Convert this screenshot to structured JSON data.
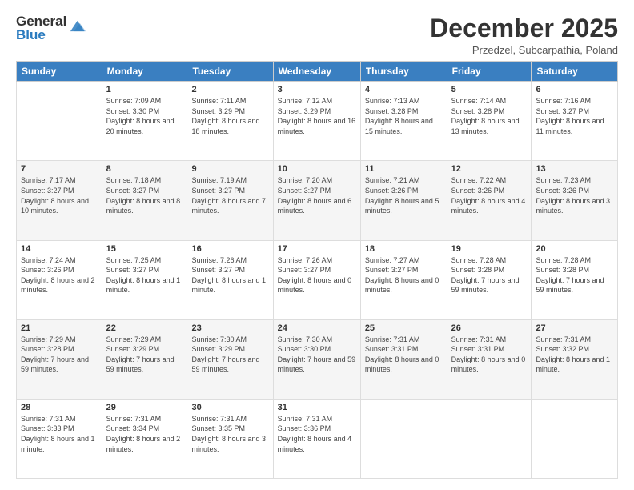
{
  "logo": {
    "general": "General",
    "blue": "Blue"
  },
  "header": {
    "month": "December 2025",
    "location": "Przedzel, Subcarpathia, Poland"
  },
  "days_of_week": [
    "Sunday",
    "Monday",
    "Tuesday",
    "Wednesday",
    "Thursday",
    "Friday",
    "Saturday"
  ],
  "weeks": [
    [
      {
        "day": "",
        "sunrise": "",
        "sunset": "",
        "daylight": ""
      },
      {
        "day": "1",
        "sunrise": "Sunrise: 7:09 AM",
        "sunset": "Sunset: 3:30 PM",
        "daylight": "Daylight: 8 hours and 20 minutes."
      },
      {
        "day": "2",
        "sunrise": "Sunrise: 7:11 AM",
        "sunset": "Sunset: 3:29 PM",
        "daylight": "Daylight: 8 hours and 18 minutes."
      },
      {
        "day": "3",
        "sunrise": "Sunrise: 7:12 AM",
        "sunset": "Sunset: 3:29 PM",
        "daylight": "Daylight: 8 hours and 16 minutes."
      },
      {
        "day": "4",
        "sunrise": "Sunrise: 7:13 AM",
        "sunset": "Sunset: 3:28 PM",
        "daylight": "Daylight: 8 hours and 15 minutes."
      },
      {
        "day": "5",
        "sunrise": "Sunrise: 7:14 AM",
        "sunset": "Sunset: 3:28 PM",
        "daylight": "Daylight: 8 hours and 13 minutes."
      },
      {
        "day": "6",
        "sunrise": "Sunrise: 7:16 AM",
        "sunset": "Sunset: 3:27 PM",
        "daylight": "Daylight: 8 hours and 11 minutes."
      }
    ],
    [
      {
        "day": "7",
        "sunrise": "Sunrise: 7:17 AM",
        "sunset": "Sunset: 3:27 PM",
        "daylight": "Daylight: 8 hours and 10 minutes."
      },
      {
        "day": "8",
        "sunrise": "Sunrise: 7:18 AM",
        "sunset": "Sunset: 3:27 PM",
        "daylight": "Daylight: 8 hours and 8 minutes."
      },
      {
        "day": "9",
        "sunrise": "Sunrise: 7:19 AM",
        "sunset": "Sunset: 3:27 PM",
        "daylight": "Daylight: 8 hours and 7 minutes."
      },
      {
        "day": "10",
        "sunrise": "Sunrise: 7:20 AM",
        "sunset": "Sunset: 3:27 PM",
        "daylight": "Daylight: 8 hours and 6 minutes."
      },
      {
        "day": "11",
        "sunrise": "Sunrise: 7:21 AM",
        "sunset": "Sunset: 3:26 PM",
        "daylight": "Daylight: 8 hours and 5 minutes."
      },
      {
        "day": "12",
        "sunrise": "Sunrise: 7:22 AM",
        "sunset": "Sunset: 3:26 PM",
        "daylight": "Daylight: 8 hours and 4 minutes."
      },
      {
        "day": "13",
        "sunrise": "Sunrise: 7:23 AM",
        "sunset": "Sunset: 3:26 PM",
        "daylight": "Daylight: 8 hours and 3 minutes."
      }
    ],
    [
      {
        "day": "14",
        "sunrise": "Sunrise: 7:24 AM",
        "sunset": "Sunset: 3:26 PM",
        "daylight": "Daylight: 8 hours and 2 minutes."
      },
      {
        "day": "15",
        "sunrise": "Sunrise: 7:25 AM",
        "sunset": "Sunset: 3:27 PM",
        "daylight": "Daylight: 8 hours and 1 minute."
      },
      {
        "day": "16",
        "sunrise": "Sunrise: 7:26 AM",
        "sunset": "Sunset: 3:27 PM",
        "daylight": "Daylight: 8 hours and 1 minute."
      },
      {
        "day": "17",
        "sunrise": "Sunrise: 7:26 AM",
        "sunset": "Sunset: 3:27 PM",
        "daylight": "Daylight: 8 hours and 0 minutes."
      },
      {
        "day": "18",
        "sunrise": "Sunrise: 7:27 AM",
        "sunset": "Sunset: 3:27 PM",
        "daylight": "Daylight: 8 hours and 0 minutes."
      },
      {
        "day": "19",
        "sunrise": "Sunrise: 7:28 AM",
        "sunset": "Sunset: 3:28 PM",
        "daylight": "Daylight: 7 hours and 59 minutes."
      },
      {
        "day": "20",
        "sunrise": "Sunrise: 7:28 AM",
        "sunset": "Sunset: 3:28 PM",
        "daylight": "Daylight: 7 hours and 59 minutes."
      }
    ],
    [
      {
        "day": "21",
        "sunrise": "Sunrise: 7:29 AM",
        "sunset": "Sunset: 3:28 PM",
        "daylight": "Daylight: 7 hours and 59 minutes."
      },
      {
        "day": "22",
        "sunrise": "Sunrise: 7:29 AM",
        "sunset": "Sunset: 3:29 PM",
        "daylight": "Daylight: 7 hours and 59 minutes."
      },
      {
        "day": "23",
        "sunrise": "Sunrise: 7:30 AM",
        "sunset": "Sunset: 3:29 PM",
        "daylight": "Daylight: 7 hours and 59 minutes."
      },
      {
        "day": "24",
        "sunrise": "Sunrise: 7:30 AM",
        "sunset": "Sunset: 3:30 PM",
        "daylight": "Daylight: 7 hours and 59 minutes."
      },
      {
        "day": "25",
        "sunrise": "Sunrise: 7:31 AM",
        "sunset": "Sunset: 3:31 PM",
        "daylight": "Daylight: 8 hours and 0 minutes."
      },
      {
        "day": "26",
        "sunrise": "Sunrise: 7:31 AM",
        "sunset": "Sunset: 3:31 PM",
        "daylight": "Daylight: 8 hours and 0 minutes."
      },
      {
        "day": "27",
        "sunrise": "Sunrise: 7:31 AM",
        "sunset": "Sunset: 3:32 PM",
        "daylight": "Daylight: 8 hours and 1 minute."
      }
    ],
    [
      {
        "day": "28",
        "sunrise": "Sunrise: 7:31 AM",
        "sunset": "Sunset: 3:33 PM",
        "daylight": "Daylight: 8 hours and 1 minute."
      },
      {
        "day": "29",
        "sunrise": "Sunrise: 7:31 AM",
        "sunset": "Sunset: 3:34 PM",
        "daylight": "Daylight: 8 hours and 2 minutes."
      },
      {
        "day": "30",
        "sunrise": "Sunrise: 7:31 AM",
        "sunset": "Sunset: 3:35 PM",
        "daylight": "Daylight: 8 hours and 3 minutes."
      },
      {
        "day": "31",
        "sunrise": "Sunrise: 7:31 AM",
        "sunset": "Sunset: 3:36 PM",
        "daylight": "Daylight: 8 hours and 4 minutes."
      },
      {
        "day": "",
        "sunrise": "",
        "sunset": "",
        "daylight": ""
      },
      {
        "day": "",
        "sunrise": "",
        "sunset": "",
        "daylight": ""
      },
      {
        "day": "",
        "sunrise": "",
        "sunset": "",
        "daylight": ""
      }
    ]
  ]
}
